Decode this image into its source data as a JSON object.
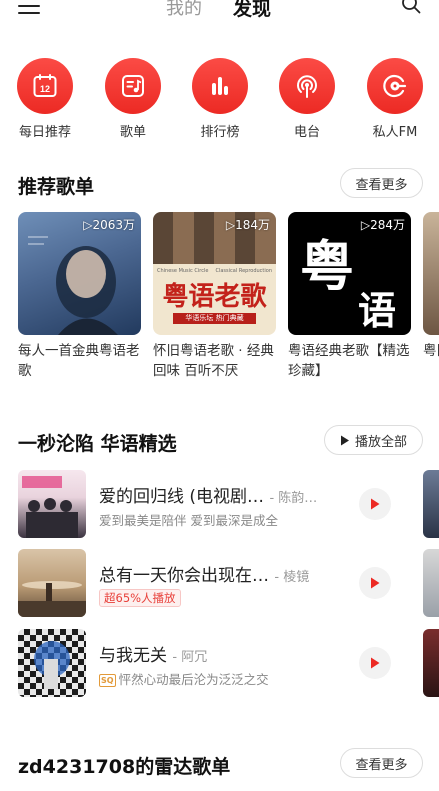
{
  "header": {
    "tab_mine": "我的",
    "tab_discover": "发现"
  },
  "quick_entries": [
    {
      "label": "每日推荐",
      "icon": "calendar-icon",
      "calendar_day": "12"
    },
    {
      "label": "歌单",
      "icon": "playlist-icon"
    },
    {
      "label": "排行榜",
      "icon": "chart-bars-icon"
    },
    {
      "label": "电台",
      "icon": "radio-icon"
    },
    {
      "label": "私人FM",
      "icon": "fm-icon"
    }
  ],
  "recommended": {
    "title": "推荐歌单",
    "more": "查看更多",
    "playlists": [
      {
        "count": "▷2063万",
        "title": "每人一首金典粤语老歌",
        "cover_text": ""
      },
      {
        "count": "▷184万",
        "title": "怀旧粤语老歌 · 经典回味 百听不厌",
        "cover_text": "粤语老歌",
        "cover_banner": "华语乐坛 热门典藏",
        "cover_sub_left": "Chinese Music Circle",
        "cover_sub_right": "Classical Reproduction"
      },
      {
        "count": "▷284万",
        "title": "粤语经典老歌【精选珍藏】",
        "cover_text": "粤",
        "cover_text2": "语"
      },
      {
        "count": "",
        "title": "粤旧",
        "cover_text": ""
      }
    ]
  },
  "featured": {
    "title": "一秒沦陷 华语精选",
    "play_all": "播放全部",
    "songs": [
      {
        "title": "爱的回归线 (电视剧…",
        "artist": "- 陈韵…",
        "sub": "爱到最美是陪伴 爱到最深是成全",
        "badge": "",
        "sq": ""
      },
      {
        "title": "总有一天你会出现在…",
        "artist": "- 棱镜",
        "sub": "",
        "badge": "超65%人播放",
        "sq": ""
      },
      {
        "title": "与我无关",
        "artist": "- 阿冗",
        "sub": "怦然心动最后沦为泛泛之交",
        "badge": "",
        "sq": "SQ"
      }
    ]
  },
  "radar": {
    "title": "zd4231708的雷达歌单",
    "more": "查看更多"
  },
  "colors": {
    "accent": "#ec2a24",
    "text": "#222222",
    "muted": "#888888"
  }
}
